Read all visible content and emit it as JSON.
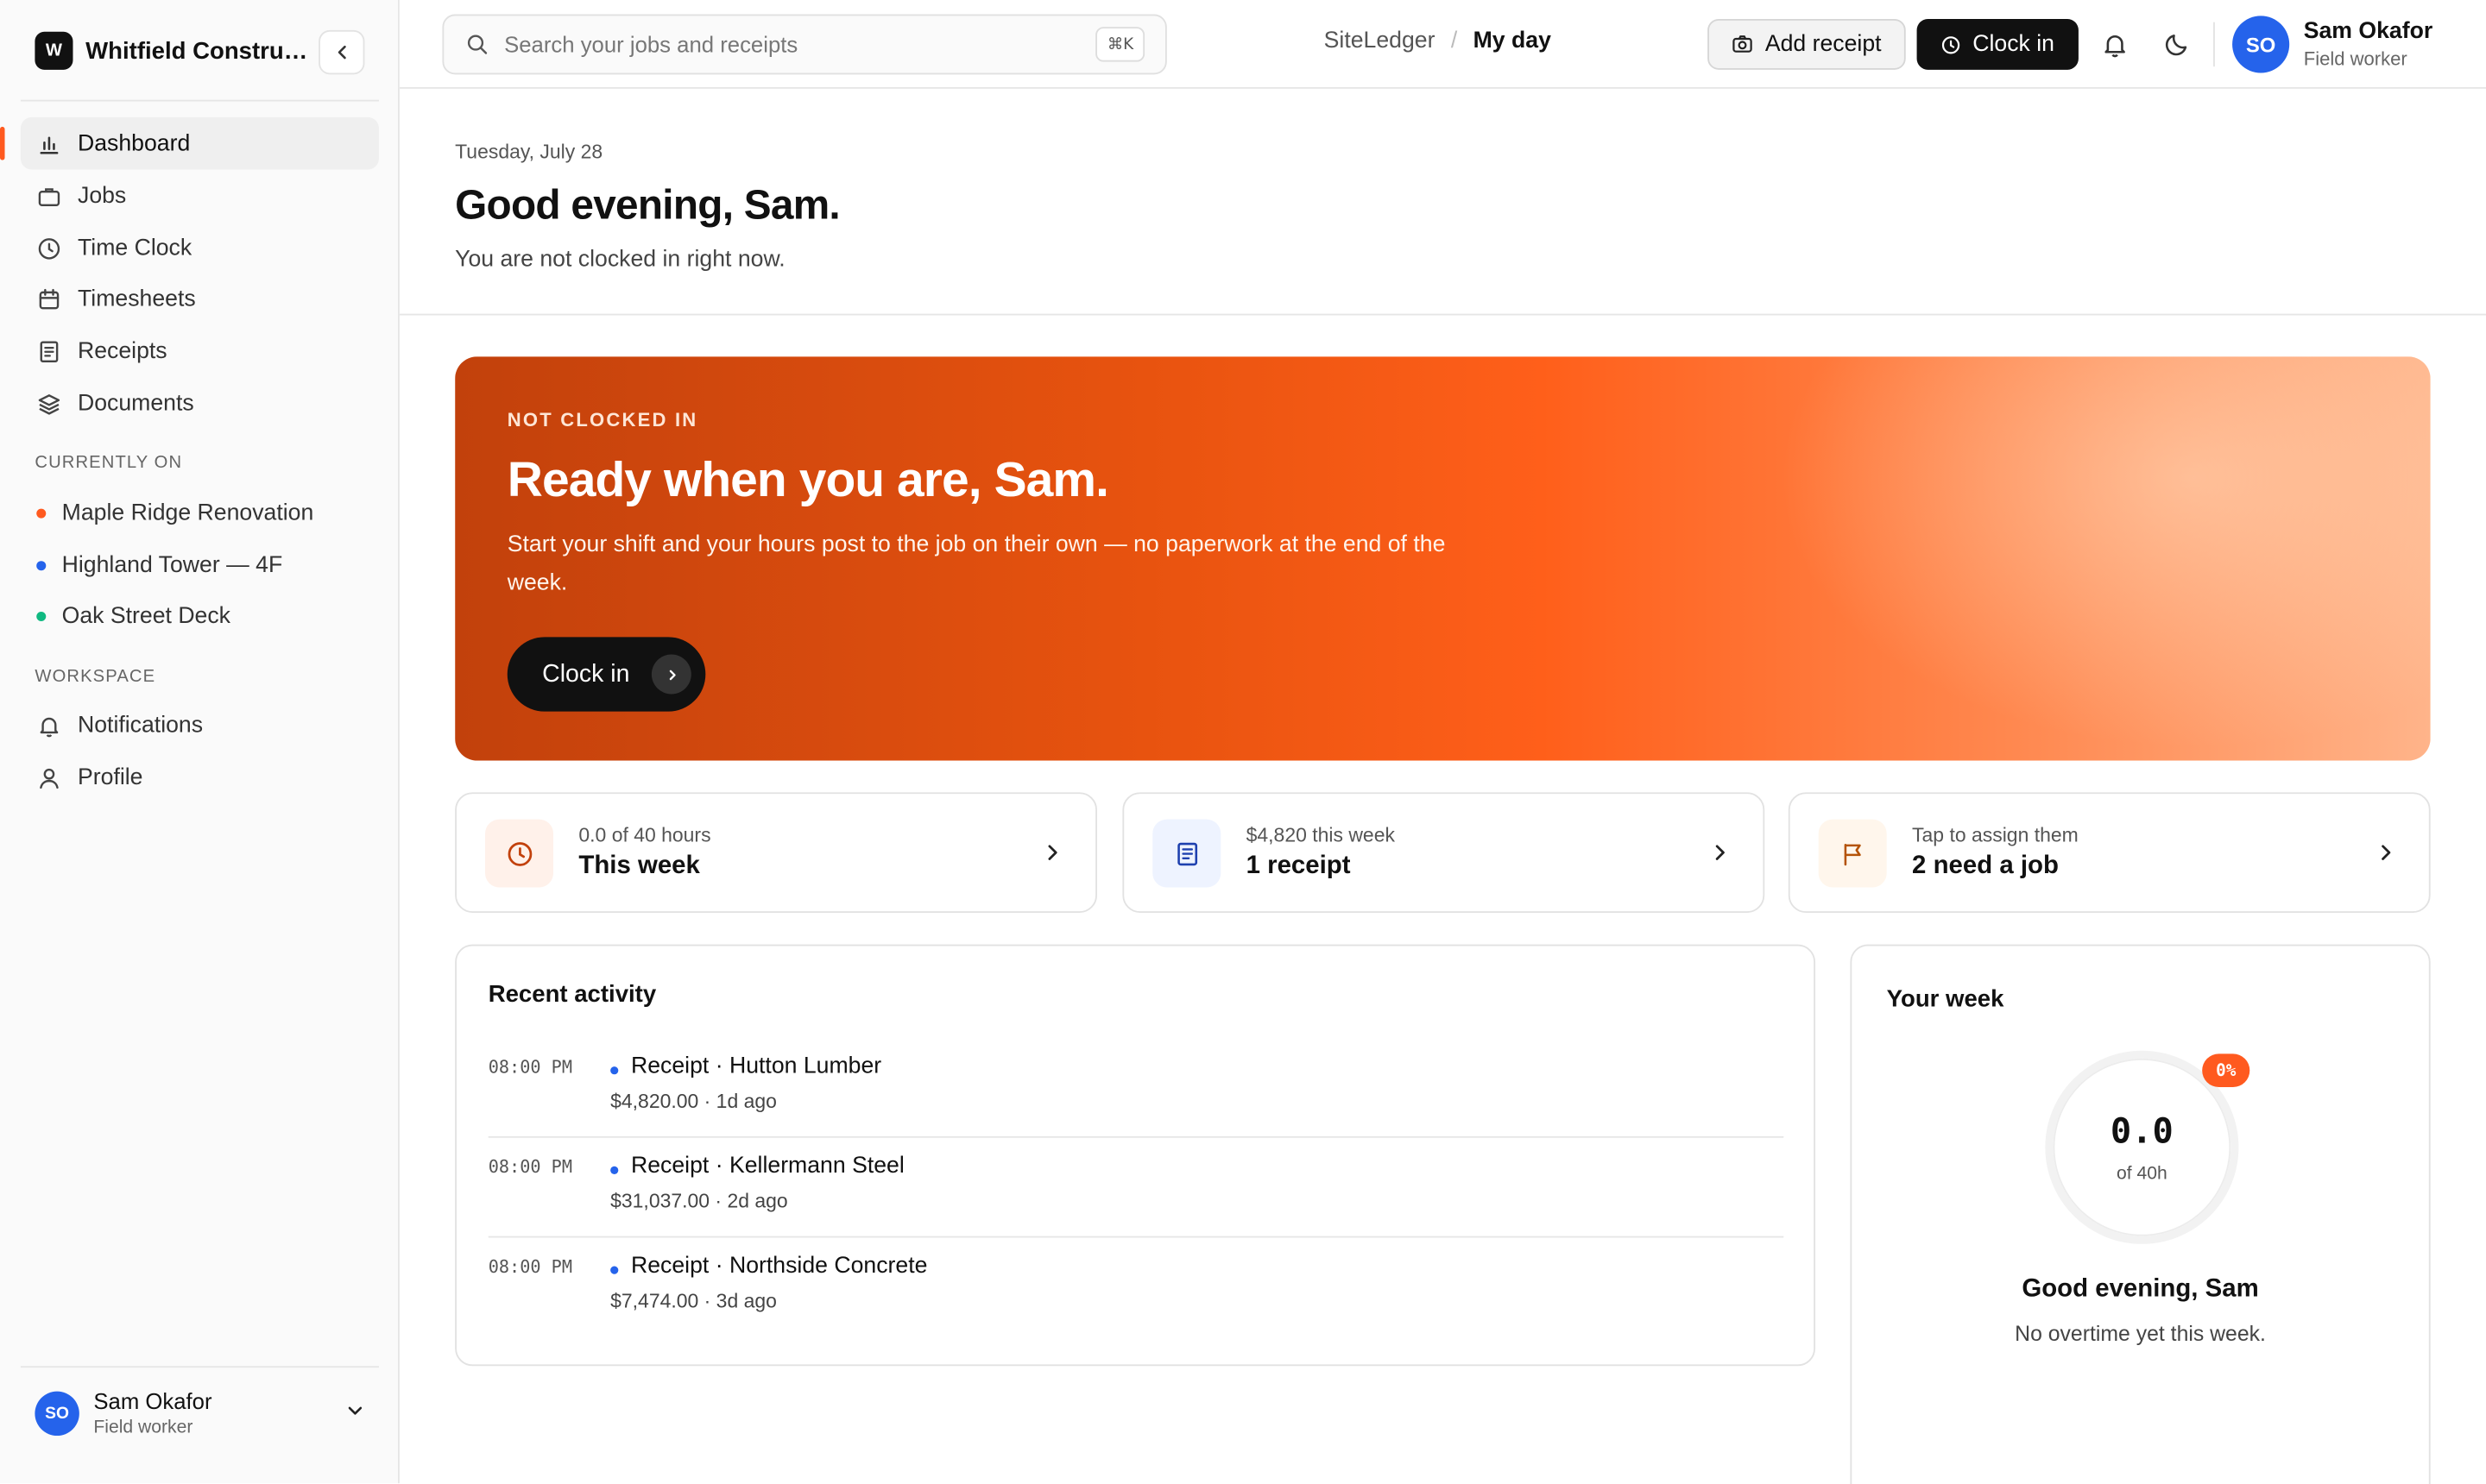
{
  "app": {
    "org_name": "Whitfield Construction",
    "org_initial": "W"
  },
  "sidebar": {
    "nav": [
      {
        "label": "Dashboard",
        "icon": "bar-chart-icon",
        "active": true
      },
      {
        "label": "Jobs",
        "icon": "briefcase-icon"
      },
      {
        "label": "Time Clock",
        "icon": "clock-icon"
      },
      {
        "label": "Timesheets",
        "icon": "calendar-icon"
      },
      {
        "label": "Receipts",
        "icon": "receipt-icon"
      },
      {
        "label": "Documents",
        "icon": "layers-icon"
      }
    ],
    "currently_on_label": "CURRENTLY ON",
    "jobs": [
      {
        "label": "Maple Ridge Renovation",
        "color": "#ff5a1f"
      },
      {
        "label": "Highland Tower — 4F",
        "color": "#2563eb"
      },
      {
        "label": "Oak Street Deck",
        "color": "#10b981"
      }
    ],
    "workspace_label": "WORKSPACE",
    "workspace": [
      {
        "label": "Notifications",
        "icon": "bell-icon"
      },
      {
        "label": "Profile",
        "icon": "user-icon"
      }
    ],
    "user": {
      "initials": "SO",
      "name": "Sam Okafor",
      "role": "Field worker"
    }
  },
  "header": {
    "search_placeholder": "Search your jobs and receipts",
    "search_shortcut": "⌘K",
    "breadcrumb": [
      "SiteLedger",
      "My day"
    ],
    "breadcrumb_sep": "/",
    "add_receipt_label": "Add receipt",
    "clock_in_label": "Clock in",
    "user": {
      "initials": "SO",
      "name": "Sam Okafor",
      "role": "Field worker"
    }
  },
  "page": {
    "date": "Tuesday, July 28",
    "greeting": "Good evening, Sam.",
    "status": "You are not clocked in right now."
  },
  "hero": {
    "kicker": "NOT CLOCKED IN",
    "title": "Ready when you are, Sam.",
    "text": "Start your shift and your hours post to the job on their own — no paperwork at the end of the week.",
    "button_label": "Clock in"
  },
  "stats": [
    {
      "sub": "0.0 of 40 hours",
      "main": "This week",
      "icon": "clock-icon",
      "icon_bg": "#fff1ea",
      "icon_color": "#c2410c"
    },
    {
      "sub": "$4,820 this week",
      "main": "1 receipt",
      "icon": "receipt-icon",
      "icon_bg": "#eef3ff",
      "icon_color": "#1e40af"
    },
    {
      "sub": "Tap to assign them",
      "main": "2 need a job",
      "icon": "flag-icon",
      "icon_bg": "#fff6ec",
      "icon_color": "#b45309"
    }
  ],
  "activity": {
    "title": "Recent activity",
    "items": [
      {
        "time": "08:00 PM",
        "title": "Receipt · Hutton Lumber",
        "meta": "$4,820.00 · 1d ago"
      },
      {
        "time": "08:00 PM",
        "title": "Receipt · Kellermann Steel",
        "meta": "$31,037.00 · 2d ago"
      },
      {
        "time": "08:00 PM",
        "title": "Receipt · Northside Concrete",
        "meta": "$7,474.00 · 3d ago"
      }
    ]
  },
  "week": {
    "title": "Your week",
    "hours_value": "0.0",
    "hours_of": "of 40h",
    "percent_label": "0%",
    "percent": 0,
    "greeting": "Good evening, Sam",
    "note": "No overtime yet this week."
  },
  "colors": {
    "accent": "#ff5a1f",
    "dark": "#111111",
    "avatar": "#2563eb"
  }
}
